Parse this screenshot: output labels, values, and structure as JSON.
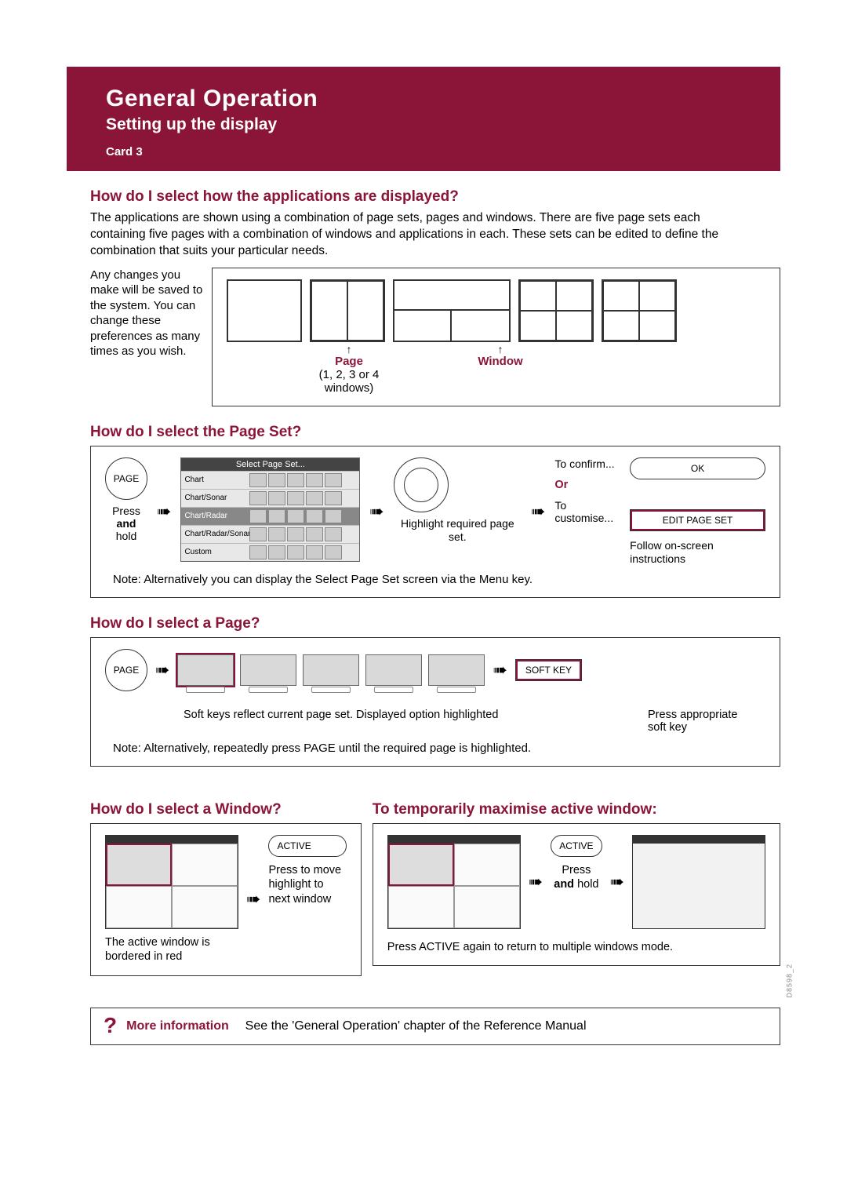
{
  "header": {
    "title": "General Operation",
    "subtitle": "Setting up the display",
    "card": "Card 3"
  },
  "s1": {
    "title": "How do I select how the applications are displayed?",
    "para": "The applications are shown using a combination of page sets, pages and windows. There are five page sets each containing five pages with a combination of windows and applications in each.  These sets can be edited to define the combination that suits your particular needs.",
    "left_note": "Any changes you make will be saved to the system. You can change these preferences as many times as you wish.",
    "page_label": "Page",
    "page_sub": "(1, 2, 3 or 4 windows)",
    "window_label": "Window"
  },
  "s2": {
    "title": "How do I select the Page Set?",
    "page_btn": "PAGE",
    "press_hold_1": "Press",
    "press_hold_2": "and",
    "press_hold_3": "hold",
    "table_head": "Select Page Set...",
    "table_rows": [
      "Chart",
      "Chart/Sonar",
      "Chart/Radar",
      "Chart/Radar/Sonar",
      "Custom"
    ],
    "highlight_txt": "Highlight required page set.",
    "or": "Or",
    "confirm": "To confirm...",
    "ok": "OK",
    "customise": "To customise...",
    "edit": "EDIT PAGE SET",
    "follow": "Follow on-screen instructions",
    "note": "Note:  Alternatively you can display the Select Page Set screen via the Menu key."
  },
  "s3": {
    "title": "How do I select a Page?",
    "page_btn": "PAGE",
    "softkey": "SOFT KEY",
    "caption_left": "Soft keys reflect current page set.  Displayed option highlighted",
    "caption_right": "Press appropriate soft key",
    "note": "Note:  Alternatively, repeatedly press PAGE until the required page is highlighted."
  },
  "s4a": {
    "title": "How do I select a Window?",
    "active": "ACTIVE",
    "cap1": "The active window is bordered in red",
    "cap2": "Press to move highlight to next window"
  },
  "s4b": {
    "title": "To temporarily maximise active window:",
    "active": "ACTIVE",
    "press": "Press",
    "and": "and",
    "hold": "hold",
    "cap": "Press ACTIVE again to return to multiple windows mode."
  },
  "moreinfo": {
    "label": "More information",
    "text": "See the 'General Operation' chapter of the Reference Manual"
  },
  "sidecode": "D8598_2"
}
